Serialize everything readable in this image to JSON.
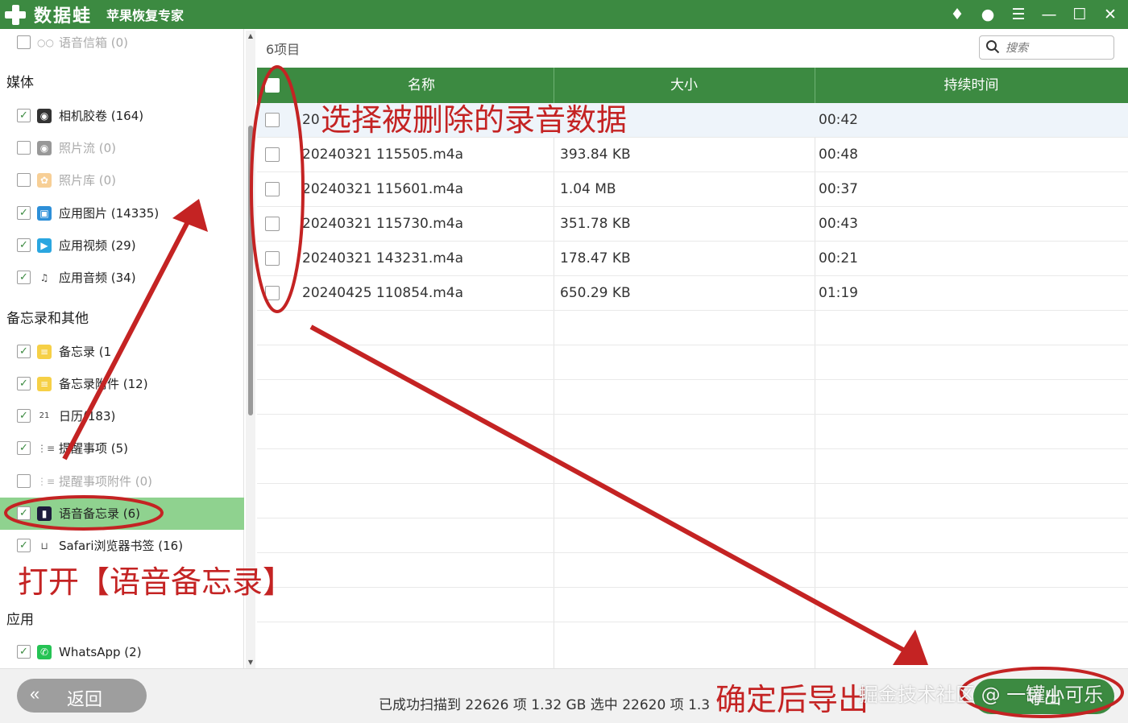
{
  "titlebar": {
    "app_name": "数据蛙",
    "app_subtitle": "苹果恢复专家",
    "controls": {
      "vip": "♦",
      "chat": "●",
      "menu": "☰",
      "minimize": "—",
      "maximize": "☐",
      "close": "✕"
    }
  },
  "sidebar": {
    "sections": {
      "media": "媒体",
      "notes": "备忘录和其他",
      "apps": "应用"
    },
    "items": [
      {
        "label": "语音信箱 (0)",
        "checked": false
      },
      {
        "label": "相机胶卷 (164)",
        "checked": true
      },
      {
        "label": "照片流 (0)",
        "checked": false
      },
      {
        "label": "照片库 (0)",
        "checked": false
      },
      {
        "label": "应用图片 (14335)",
        "checked": true
      },
      {
        "label": "应用视频 (29)",
        "checked": true
      },
      {
        "label": "应用音频 (34)",
        "checked": true
      },
      {
        "label": "备忘录 (1",
        "checked": true
      },
      {
        "label": "备忘录附件 (12)",
        "checked": true
      },
      {
        "label": "日历(183)",
        "checked": true
      },
      {
        "label": "提醒事项 (5)",
        "checked": true
      },
      {
        "label": "提醒事项附件 (0)",
        "checked": false
      },
      {
        "label": "语音备忘录 (6)",
        "checked": true
      },
      {
        "label": "Safari浏览器书签 (16)",
        "checked": true
      },
      {
        "label": "WhatsApp (2)",
        "checked": true
      }
    ]
  },
  "main": {
    "count_label": "6项目",
    "search_placeholder": "搜索",
    "columns": {
      "name": "名称",
      "size": "大小",
      "duration": "持续时间"
    },
    "rows": [
      {
        "name": "20",
        "size": "",
        "duration": "00:42"
      },
      {
        "name": "20240321 115505.m4a",
        "size": "393.84 KB",
        "duration": "00:48"
      },
      {
        "name": "20240321 115601.m4a",
        "size": "1.04 MB",
        "duration": "00:37"
      },
      {
        "name": "20240321 115730.m4a",
        "size": "351.78 KB",
        "duration": "00:43"
      },
      {
        "name": "20240321 143231.m4a",
        "size": "178.47 KB",
        "duration": "00:21"
      },
      {
        "name": "20240425 110854.m4a",
        "size": "650.29 KB",
        "duration": "01:19"
      }
    ]
  },
  "footer": {
    "back_label": "返回",
    "status": "已成功扫描到 22626 项 1.32 GB  选中 22620 项 1.3",
    "export_label": "导出"
  },
  "annotations": {
    "select_deleted": "选择被删除的录音数据",
    "open_voice_memo": "打开【语音备忘录】",
    "confirm_export": "确定后导出",
    "watermark": "掘金技术社区 @ 一罐小可乐"
  },
  "colors": {
    "brand_green": "#3c8a41",
    "selected_row": "#8fd28f",
    "annotation_red": "#c42323"
  }
}
